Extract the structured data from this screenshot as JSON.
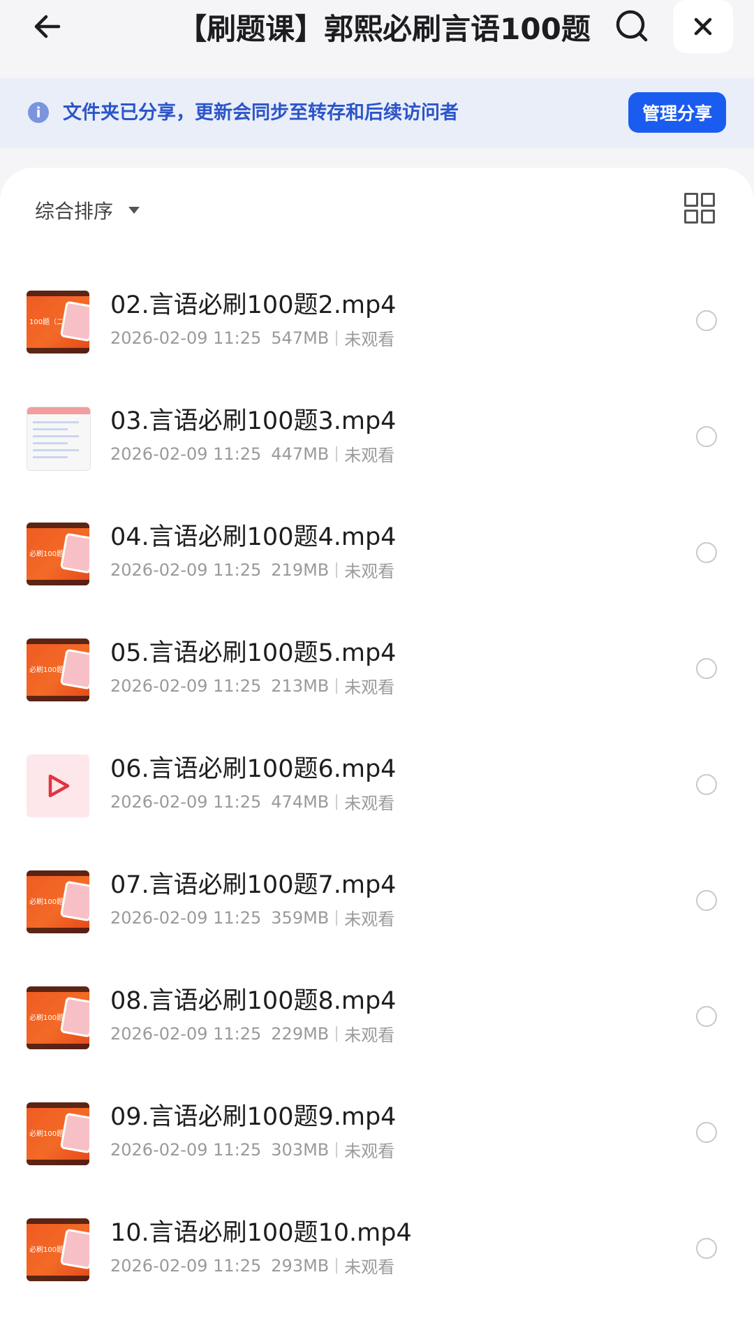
{
  "header": {
    "title": "【刷题课】郭熙必刷言语100题"
  },
  "banner": {
    "text": "文件夹已分享，更新会同步至转存和后续访问者",
    "button": "管理分享"
  },
  "toolbar": {
    "sort_label": "综合排序"
  },
  "files": [
    {
      "name": "02.言语必刷100题2.mp4",
      "date": "2026-02-09 11:25",
      "size": "547MB",
      "status": "未观看",
      "thumb": "orange",
      "caption": "100题（二）"
    },
    {
      "name": "03.言语必刷100题3.mp4",
      "date": "2026-02-09 11:25",
      "size": "447MB",
      "status": "未观看",
      "thumb": "doc",
      "caption": ""
    },
    {
      "name": "04.言语必刷100题4.mp4",
      "date": "2026-02-09 11:25",
      "size": "219MB",
      "status": "未观看",
      "thumb": "orange",
      "caption": "必刷100题（四）"
    },
    {
      "name": "05.言语必刷100题5.mp4",
      "date": "2026-02-09 11:25",
      "size": "213MB",
      "status": "未观看",
      "thumb": "orange",
      "caption": "必刷100题（五）"
    },
    {
      "name": "06.言语必刷100题6.mp4",
      "date": "2026-02-09 11:25",
      "size": "474MB",
      "status": "未观看",
      "thumb": "play",
      "caption": ""
    },
    {
      "name": "07.言语必刷100题7.mp4",
      "date": "2026-02-09 11:25",
      "size": "359MB",
      "status": "未观看",
      "thumb": "orange",
      "caption": "必刷100题（七）"
    },
    {
      "name": "08.言语必刷100题8.mp4",
      "date": "2026-02-09 11:25",
      "size": "229MB",
      "status": "未观看",
      "thumb": "orange",
      "caption": "必刷100题（八）"
    },
    {
      "name": "09.言语必刷100题9.mp4",
      "date": "2026-02-09 11:25",
      "size": "303MB",
      "status": "未观看",
      "thumb": "orange",
      "caption": "必刷100题（九）"
    },
    {
      "name": "10.言语必刷100题10.mp4",
      "date": "2026-02-09 11:25",
      "size": "293MB",
      "status": "未观看",
      "thumb": "orange",
      "caption": "必刷100题（十）"
    }
  ],
  "colors": {
    "accent": "#1a5cf0",
    "banner_bg": "#e9eef9",
    "banner_text": "#2c55c9",
    "thumb_orange": "#ef5a22"
  },
  "icons": {
    "back": "arrow-left-icon",
    "search": "search-icon",
    "close": "close-icon",
    "info": "info-icon",
    "sort": "caret-down-icon",
    "grid": "grid-view-icon",
    "select": "radio-circle-icon",
    "play": "play-icon"
  }
}
